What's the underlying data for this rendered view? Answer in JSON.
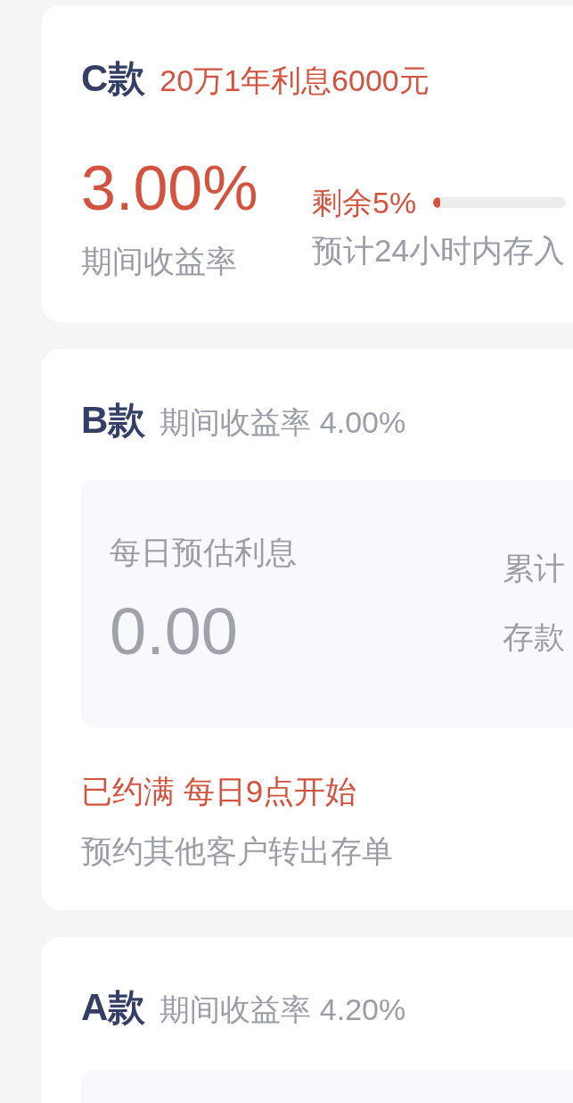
{
  "products": [
    {
      "kind": "offer",
      "name": "C款",
      "tagline": "20万1年利息6000元",
      "rate": "3.00%",
      "rate_label": "期间收益率",
      "quota": {
        "label": "剩余5%",
        "level": 0.05
      },
      "note": "预计24小时内存入"
    },
    {
      "kind": "booking",
      "name": "B款",
      "tagline": "期间收益率 4.00%",
      "stats": {
        "label": "每日预估利息",
        "value": "0.00",
        "column_2": [
          "累计",
          "存款"
        ]
      },
      "status": "已约满 每日9点开始",
      "note": "预约其他客户转出存单"
    },
    {
      "kind": "booking",
      "name": "A款",
      "tagline": "期间收益率 4.20%"
    }
  ]
}
